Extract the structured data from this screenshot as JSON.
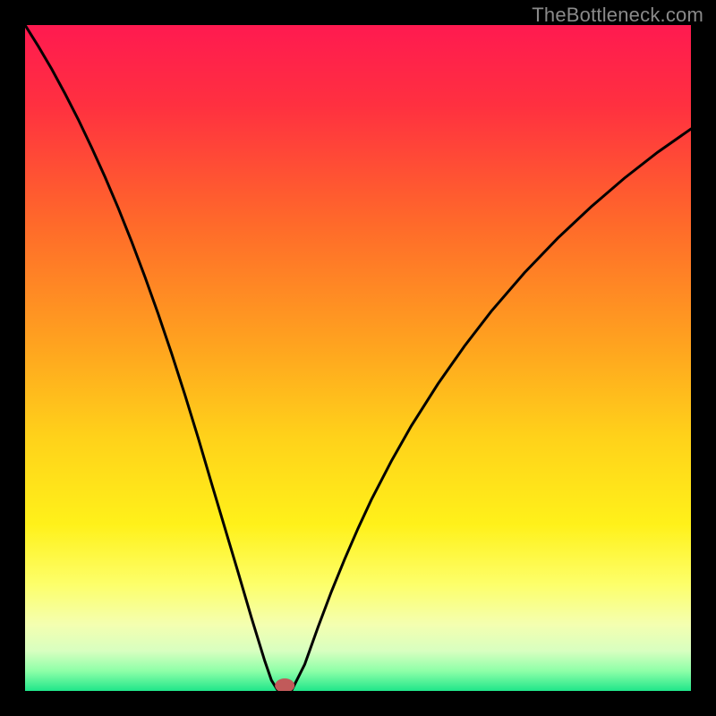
{
  "watermark": "TheBottleneck.com",
  "colors": {
    "curve": "#000000",
    "marker": "#c15a5a",
    "frame": "#000000"
  },
  "chart_data": {
    "type": "line",
    "title": "",
    "xlabel": "",
    "ylabel": "",
    "xlim": [
      0,
      100
    ],
    "ylim": [
      0,
      100
    ],
    "x": [
      0,
      2,
      4,
      6,
      8,
      10,
      12,
      14,
      16,
      18,
      20,
      22,
      24,
      26,
      28,
      30,
      32,
      34,
      36,
      37,
      38,
      39,
      40,
      42,
      44,
      46,
      48,
      50,
      52,
      55,
      58,
      62,
      66,
      70,
      75,
      80,
      85,
      90,
      95,
      100
    ],
    "values": [
      100,
      96.8,
      93.4,
      89.7,
      85.8,
      81.6,
      77.2,
      72.5,
      67.5,
      62.2,
      56.6,
      50.7,
      44.5,
      38.0,
      31.2,
      24.5,
      17.8,
      11.0,
      4.5,
      1.6,
      0.0,
      0.0,
      0.0,
      4.0,
      9.6,
      14.9,
      19.8,
      24.4,
      28.7,
      34.5,
      39.8,
      46.1,
      51.8,
      57.0,
      62.8,
      68.0,
      72.7,
      77.0,
      80.9,
      84.4
    ],
    "marker": {
      "x": 39,
      "y": 0
    },
    "grid": false,
    "legend": false
  }
}
